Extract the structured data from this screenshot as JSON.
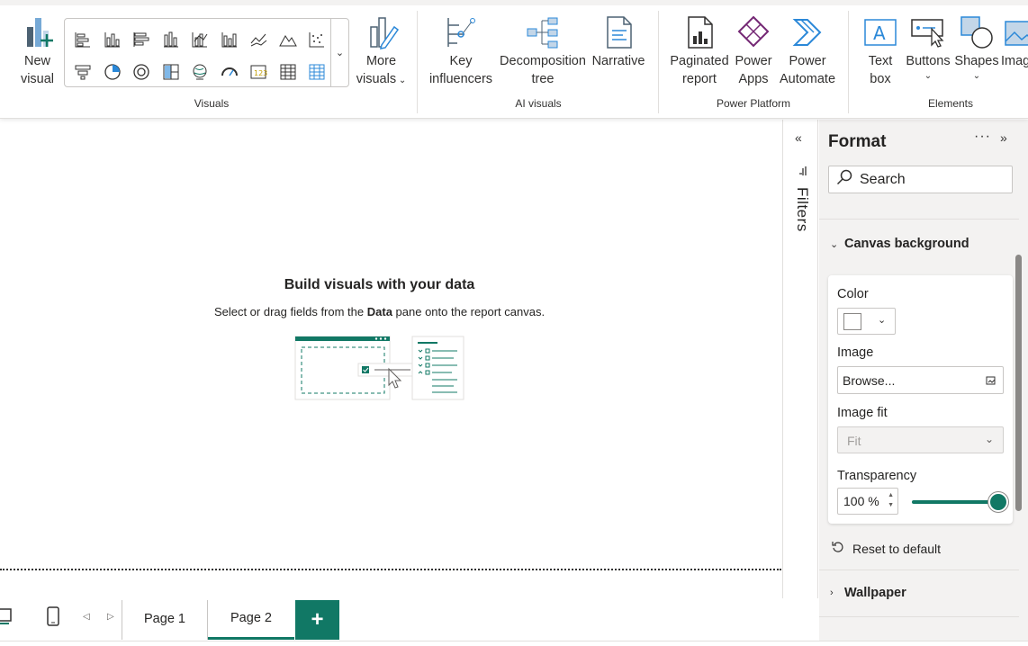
{
  "colors": {
    "accent": "#117865",
    "chart_blue": "#2b88d8",
    "powerapps_purple": "#742774"
  },
  "ribbon": {
    "new_visual": "New\nvisual",
    "visuals_group_label": "Visuals",
    "more_visuals_line1": "More",
    "more_visuals_line2": "visuals",
    "gallery_icons": [
      "stacked-bar-icon",
      "stacked-column-icon",
      "clustered-bar-icon",
      "clustered-column-icon",
      "100-bar-icon",
      "100-column-icon",
      "line-chart-icon",
      "area-chart-icon",
      "scatter-chart-icon",
      "funnel-icon",
      "pie-chart-icon",
      "donut-chart-icon",
      "treemap-icon",
      "map-icon",
      "gauge-icon",
      "card-icon",
      "table-icon",
      "matrix-icon"
    ],
    "key_influencers_line1": "Key",
    "key_influencers_line2": "influencers",
    "decomposition_line1": "Decomposition",
    "decomposition_line2": "tree",
    "narrative": "Narrative",
    "ai_group_label": "AI visuals",
    "paginated_line1": "Paginated",
    "paginated_line2": "report",
    "power_apps_line1": "Power",
    "power_apps_line2": "Apps",
    "power_automate_line1": "Power",
    "power_automate_line2": "Automate",
    "platform_group_label": "Power Platform",
    "text_box_line1": "Text",
    "text_box_line2": "box",
    "buttons": "Buttons",
    "shapes": "Shapes",
    "image": "Imag",
    "elements_group_label": "Elements"
  },
  "canvas": {
    "empty_title": "Build visuals with your data",
    "empty_sub_pre": "Select or drag fields from the ",
    "empty_sub_bold": "Data",
    "empty_sub_post": " pane onto the report canvas."
  },
  "filters": {
    "label": "Filters"
  },
  "format_pane": {
    "title": "Format",
    "more": "···",
    "search_placeholder": "Search",
    "section_canvas_background": "Canvas background",
    "color_label": "Color",
    "color_value": "#FFFFFF",
    "image_label": "Image",
    "browse_label": "Browse...",
    "image_fit_label": "Image fit",
    "image_fit_value": "Fit",
    "transparency_label": "Transparency",
    "transparency_value": "100 %",
    "transparency_level": 1.0,
    "reset_label": "Reset to default",
    "section_wallpaper": "Wallpaper"
  },
  "pages": {
    "tabs": [
      "Page 1",
      "Page 2"
    ],
    "active": "Page 2",
    "add": "+"
  }
}
